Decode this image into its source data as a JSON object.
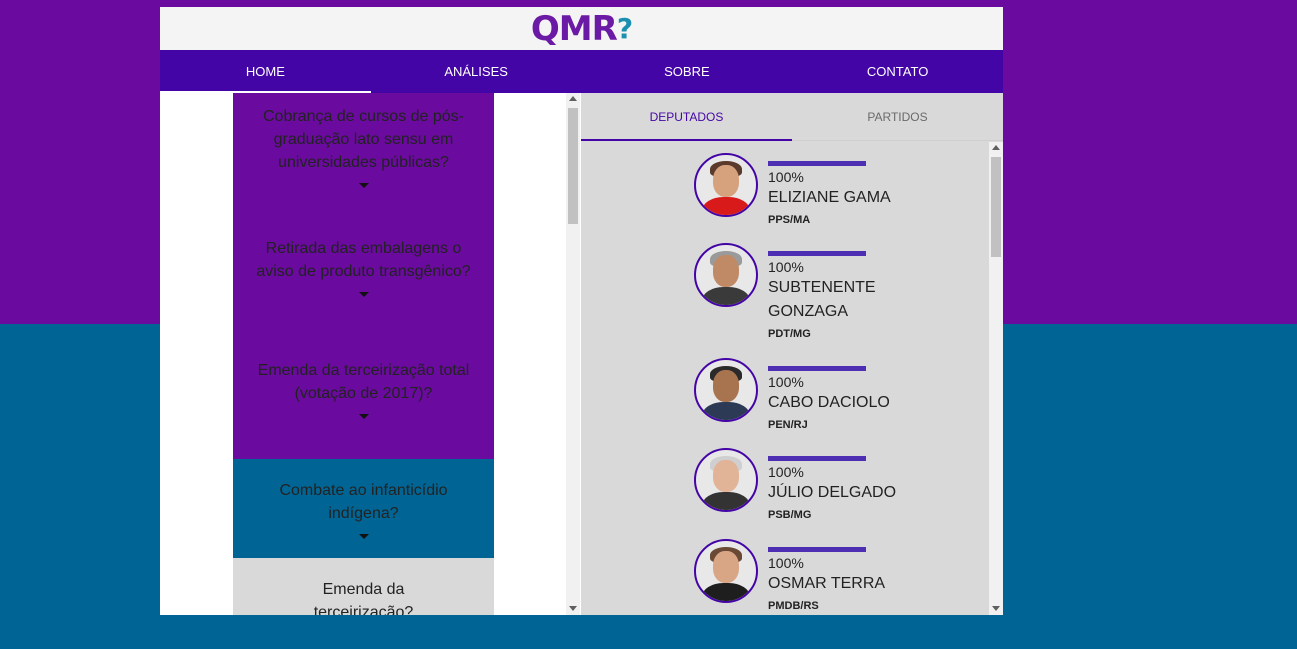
{
  "logo": {
    "text_qm": "QMR",
    "text_symbol": "?"
  },
  "nav": {
    "items": [
      {
        "label": "HOME"
      },
      {
        "label": "ANÁLISES"
      },
      {
        "label": "SOBRE"
      },
      {
        "label": "CONTATO"
      }
    ]
  },
  "questions": [
    {
      "text": "Cobrança de cursos de pós-graduação lato sensu em universidades públicas?",
      "color": "#6a0a9e"
    },
    {
      "text": "Retirada das embalagens o aviso de produto transgênico?",
      "color": "#6a0a9e"
    },
    {
      "text": "Emenda da terceirização total (votação de 2017)?",
      "color": "#6a0a9e"
    },
    {
      "text": "Combate ao infanticídio indígena?",
      "color": "#006594"
    },
    {
      "text": "Emenda da terceirização?",
      "color": "#d9d9d9"
    }
  ],
  "tabs": [
    {
      "label": "DEPUTADOS"
    },
    {
      "label": "PARTIDOS"
    }
  ],
  "deputies": [
    {
      "pct": "100%",
      "name": "ELIZIANE GAMA",
      "party": "PPS/MA"
    },
    {
      "pct": "100%",
      "name": "SUBTENENTE GONZAGA",
      "party": "PDT/MG"
    },
    {
      "pct": "100%",
      "name": "CABO DACIOLO",
      "party": "PEN/RJ"
    },
    {
      "pct": "100%",
      "name": "JÚLIO DELGADO",
      "party": "PSB/MG"
    },
    {
      "pct": "100%",
      "name": "OSMAR TERRA",
      "party": "PMDB/RS"
    }
  ],
  "colors": {
    "purple_bg": "#6a0a9e",
    "teal_bg": "#006594",
    "nav_bg": "#4405a6",
    "accent": "#4e2eb3"
  }
}
